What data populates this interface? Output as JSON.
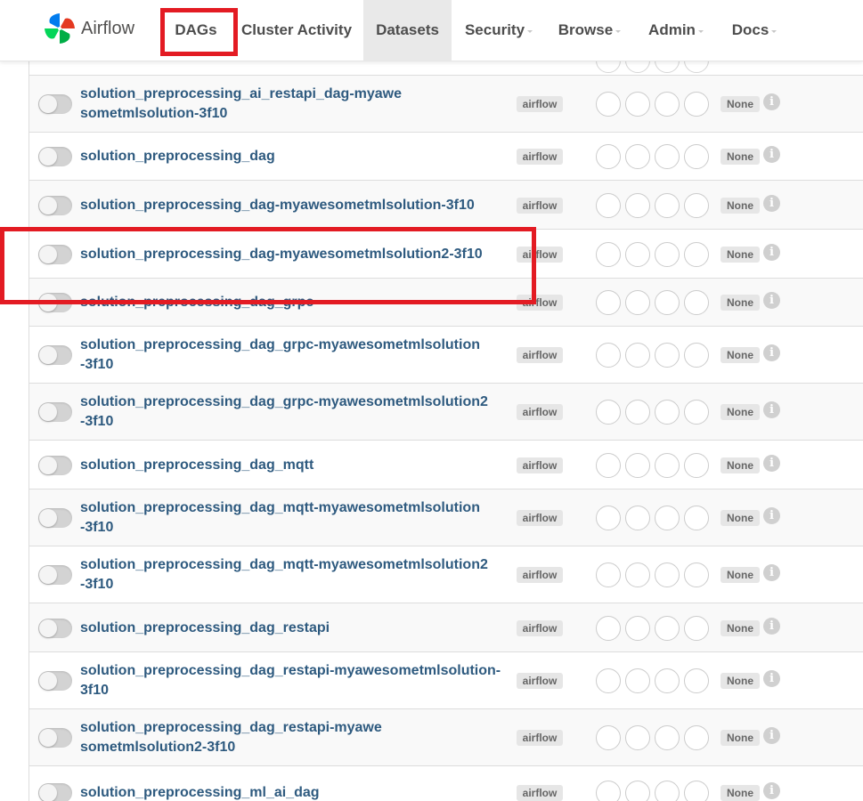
{
  "app": {
    "brand_name": "Airflow",
    "brand_colors": [
      "#017cee",
      "#00ad46",
      "#e43921",
      "#04d659"
    ]
  },
  "nav": {
    "items": [
      {
        "label": "DAGs",
        "dropdown": false
      },
      {
        "label": "Cluster Activity",
        "dropdown": false
      },
      {
        "label": "Datasets",
        "dropdown": false
      },
      {
        "label": "Security",
        "dropdown": true
      },
      {
        "label": "Browse",
        "dropdown": true
      },
      {
        "label": "Admin",
        "dropdown": true
      },
      {
        "label": "Docs",
        "dropdown": true
      }
    ]
  },
  "rows": [
    {
      "name": "solution_preprocessing_ai_restapi_dag-myawesometmlsolution-3f10",
      "owner": "airflow",
      "schedule": "None",
      "paused": true
    },
    {
      "name": "solution_preprocessing_dag",
      "owner": "airflow",
      "schedule": "None",
      "paused": true
    },
    {
      "name": "solution_preprocessing_dag-myawesometmlsolution-3f10",
      "owner": "airflow",
      "schedule": "None",
      "paused": true
    },
    {
      "name": "solution_preprocessing_dag-myawesometmlsolution2-3f10",
      "owner": "airflow",
      "schedule": "None",
      "paused": true
    },
    {
      "name": "solution_preprocessing_dag_grpc",
      "owner": "airflow",
      "schedule": "None",
      "paused": true
    },
    {
      "name": "solution_preprocessing_dag_grpc-myawesometmlsolution-3f10",
      "owner": "airflow",
      "schedule": "None",
      "paused": true
    },
    {
      "name": "solution_preprocessing_dag_grpc-myawesometmlsolution2-3f10",
      "owner": "airflow",
      "schedule": "None",
      "paused": true
    },
    {
      "name": "solution_preprocessing_dag_mqtt",
      "owner": "airflow",
      "schedule": "None",
      "paused": true
    },
    {
      "name": "solution_preprocessing_dag_mqtt-myawesometmlsolution-3f10",
      "owner": "airflow",
      "schedule": "None",
      "paused": true
    },
    {
      "name": "solution_preprocessing_dag_mqtt-myawesometmlsolution2-3f10",
      "owner": "airflow",
      "schedule": "None",
      "paused": true
    },
    {
      "name": "solution_preprocessing_dag_restapi",
      "owner": "airflow",
      "schedule": "None",
      "paused": true
    },
    {
      "name": "solution_preprocessing_dag_restapi-myawesometmlsolution-3f10",
      "owner": "airflow",
      "schedule": "None",
      "paused": true
    },
    {
      "name": "solution_preprocessing_dag_restapi-myawesometmlsolution2-3f10",
      "owner": "airflow",
      "schedule": "None",
      "paused": true
    },
    {
      "name": "solution_preprocessing_ml_ai_dag",
      "owner": "airflow",
      "schedule": "None",
      "paused": true
    }
  ],
  "info_icon_glyph": "i",
  "highlight_color": "#e31b23"
}
